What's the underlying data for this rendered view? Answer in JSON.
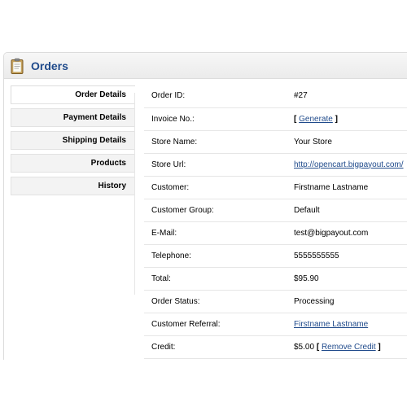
{
  "header": {
    "icon": "clipboard-icon",
    "title": "Orders"
  },
  "tabs": [
    {
      "label": "Order Details",
      "active": true
    },
    {
      "label": "Payment Details",
      "active": false
    },
    {
      "label": "Shipping Details",
      "active": false
    },
    {
      "label": "Products",
      "active": false
    },
    {
      "label": "History",
      "active": false
    }
  ],
  "details": {
    "order_id": {
      "label": "Order ID:",
      "value": "#27"
    },
    "invoice": {
      "label": "Invoice No.:",
      "bracket_open": "[",
      "link": "Generate",
      "bracket_close": "]"
    },
    "store_name": {
      "label": "Store Name:",
      "value": "Your Store"
    },
    "store_url": {
      "label": "Store Url:",
      "link": "http://opencart.bigpayout.com/"
    },
    "customer": {
      "label": "Customer:",
      "value": "Firstname Lastname"
    },
    "customer_group": {
      "label": "Customer Group:",
      "value": "Default"
    },
    "email": {
      "label": "E-Mail:",
      "value": "test@bigpayout.com"
    },
    "telephone": {
      "label": "Telephone:",
      "value": "5555555555"
    },
    "total": {
      "label": "Total:",
      "value": "$95.90"
    },
    "order_status": {
      "label": "Order Status:",
      "value": "Processing"
    },
    "customer_referral": {
      "label": "Customer Referral:",
      "link": "Firstname Lastname"
    },
    "credit": {
      "label": "Credit:",
      "value": "$5.00",
      "bracket_open": "[",
      "link": "Remove Credit",
      "bracket_close": "]"
    }
  },
  "colors": {
    "title": "#1f4a8b",
    "link": "#1f4a8b",
    "border": "#dcdcdc",
    "tab_bg": "#f3f3f3"
  }
}
